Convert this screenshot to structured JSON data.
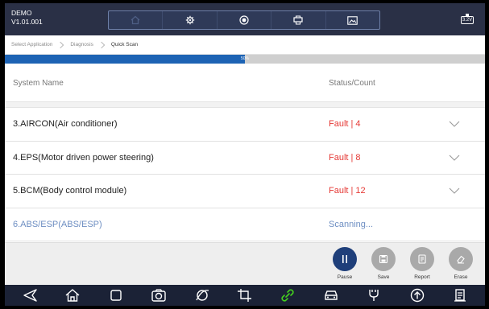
{
  "header": {
    "app_name": "DEMO",
    "version": "V1.01.001",
    "toolbar_icons": [
      "home-icon",
      "gear-icon",
      "record-icon",
      "printer-icon",
      "screenshot-icon"
    ],
    "battery_voltage": "3.2V"
  },
  "breadcrumb": {
    "items": [
      {
        "label": "Select Application"
      },
      {
        "label": "Diagnosis"
      },
      {
        "label": "Quick Scan"
      }
    ]
  },
  "progress": {
    "value_percent": 50,
    "label": "50%"
  },
  "columns": {
    "name": "System Name",
    "status": "Status/Count"
  },
  "systems": [
    {
      "name": "3.AIRCON(Air conditioner)",
      "status": "Fault | 4"
    },
    {
      "name": "4.EPS(Motor driven power steering)",
      "status": "Fault | 8"
    },
    {
      "name": "5.BCM(Body control module)",
      "status": "Fault | 12"
    },
    {
      "name": "6.ABS/ESP(ABS/ESP)",
      "status": "Scanning..."
    }
  ],
  "actions": [
    {
      "label": "Pause",
      "icon": "pause-icon"
    },
    {
      "label": "Save",
      "icon": "save-icon"
    },
    {
      "label": "Report",
      "icon": "report-icon"
    },
    {
      "label": "Erase",
      "icon": "erase-icon"
    }
  ],
  "navbar": {
    "icons": [
      "back-icon",
      "home-icon",
      "recent-apps-icon",
      "camera-icon",
      "browser-icon",
      "crop-icon",
      "link-icon",
      "car-icon",
      "vci-icon",
      "upload-icon",
      "document-icon"
    ]
  },
  "colors": {
    "header_bg": "#2a3046",
    "progress_fill": "#1d63b4",
    "fault_red": "#e53935",
    "scanning_blue": "#6d8ec2",
    "pause_button": "#1f3f7a",
    "navbar_bg": "#1b2236",
    "link_icon_green": "#44d11e"
  }
}
